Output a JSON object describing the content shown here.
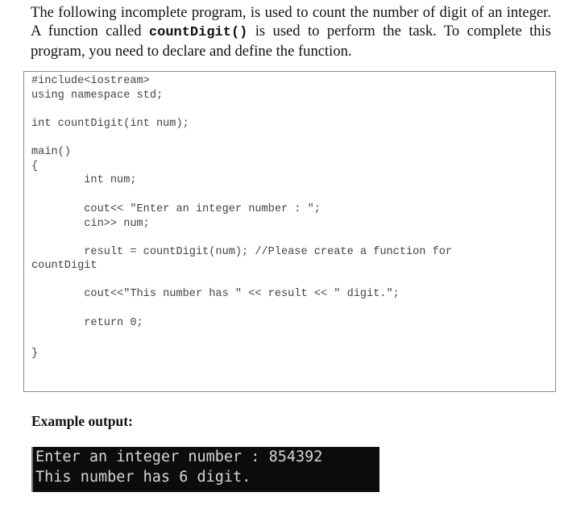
{
  "intro": {
    "text_before": "The following incomplete program, is used to count the number of digit of an integer. A function called ",
    "function_name": "countDigit()",
    "text_after": " is used to perform the task. To complete this program, you need to declare and define the function."
  },
  "code": {
    "lines": [
      "#include<iostream>",
      "using namespace std;",
      "int countDigit(int num);",
      "main()",
      "{",
      "        int num;",
      "        cout<< \"Enter an integer number : \";",
      "        cin>> num;",
      "        result = countDigit(num); //Please create a function for",
      "countDigit",
      "        cout<<\"This number has \" << result << \" digit.\";",
      "        return 0;",
      "}"
    ]
  },
  "example": {
    "heading": "Example output:",
    "console_lines": [
      "Enter an integer number : 854392",
      "This number has 6 digit."
    ]
  }
}
